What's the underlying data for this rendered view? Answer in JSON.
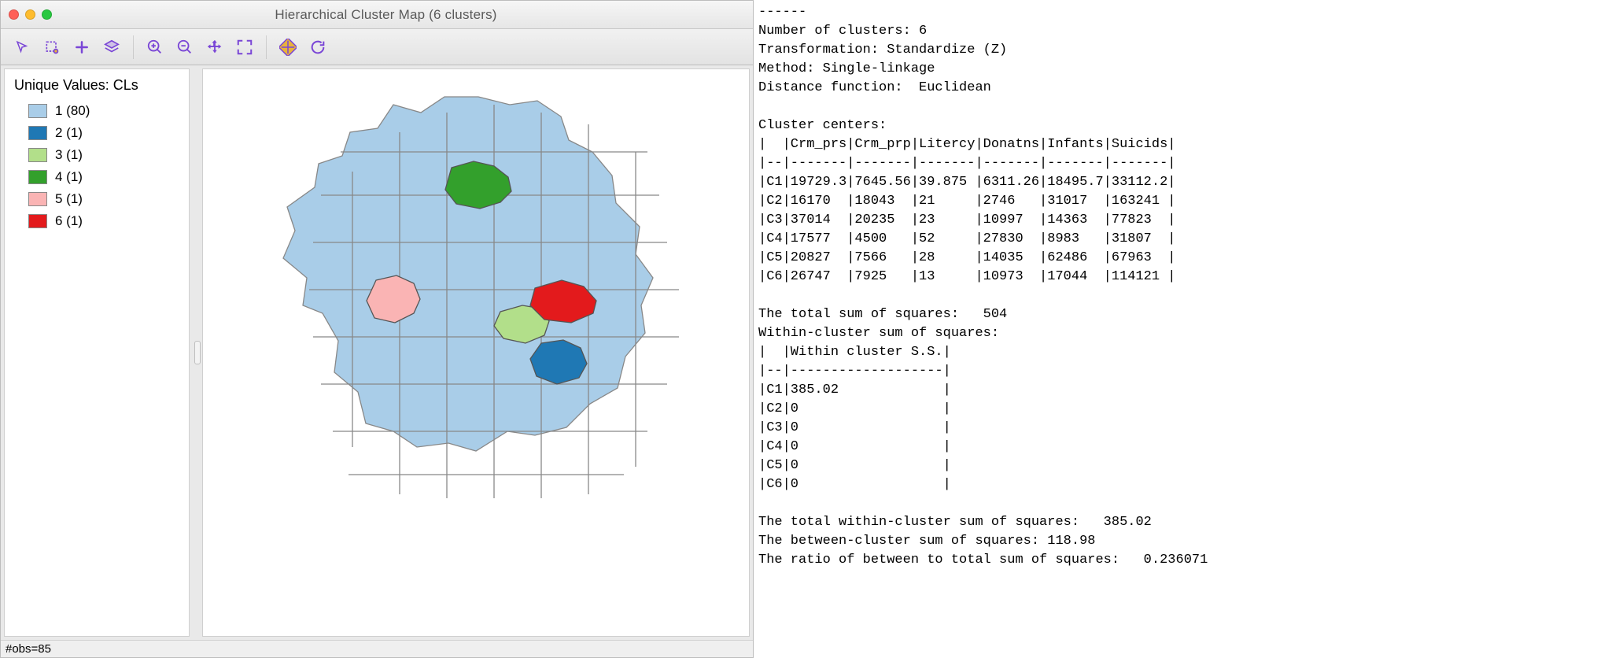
{
  "window": {
    "title": "Hierarchical Cluster Map (6 clusters)"
  },
  "toolbar": {
    "icons": [
      "pointer-icon",
      "select-rect-icon",
      "add-icon",
      "layers-icon",
      "zoom-in-icon",
      "zoom-out-icon",
      "pan-icon",
      "fit-icon",
      "basemap-icon",
      "refresh-icon"
    ]
  },
  "legend": {
    "title": "Unique Values: CLs",
    "items": [
      {
        "label": "1 (80)",
        "color": "#a9cde8"
      },
      {
        "label": "2 (1)",
        "color": "#1f78b4"
      },
      {
        "label": "3 (1)",
        "color": "#b2df8a"
      },
      {
        "label": "4 (1)",
        "color": "#33a02c"
      },
      {
        "label": "5 (1)",
        "color": "#fab4b4"
      },
      {
        "label": "6 (1)",
        "color": "#e31a1c"
      }
    ]
  },
  "statusbar": {
    "obs": "#obs=85"
  },
  "report": {
    "separator": "------",
    "num_clusters_label": "Number of clusters:",
    "num_clusters": "6",
    "transformation_label": "Transformation:",
    "transformation": "Standardize (Z)",
    "method_label": "Method:",
    "method": "Single-linkage",
    "distfn_label": "Distance function:",
    "distfn": "Euclidean",
    "centers_title": "Cluster centers:",
    "centers_header": [
      "",
      "Crm_prs",
      "Crm_prp",
      "Litercy",
      "Donatns",
      "Infants",
      "Suicids"
    ],
    "centers_rows": [
      [
        "C1",
        "19729.3",
        "7645.56",
        "39.875",
        "6311.26",
        "18495.7",
        "33112.2"
      ],
      [
        "C2",
        "16170",
        "18043",
        "21",
        "2746",
        "31017",
        "163241"
      ],
      [
        "C3",
        "37014",
        "20235",
        "23",
        "10997",
        "14363",
        "77823"
      ],
      [
        "C4",
        "17577",
        "4500",
        "52",
        "27830",
        "8983",
        "31807"
      ],
      [
        "C5",
        "20827",
        "7566",
        "28",
        "14035",
        "62486",
        "67963"
      ],
      [
        "C6",
        "26747",
        "7925",
        "13",
        "10973",
        "17044",
        "114121"
      ]
    ],
    "total_ss_label": "The total sum of squares:",
    "total_ss": "504",
    "within_title": "Within-cluster sum of squares:",
    "within_header": [
      "",
      "Within cluster S.S."
    ],
    "within_rows": [
      [
        "C1",
        "385.02"
      ],
      [
        "C2",
        "0"
      ],
      [
        "C3",
        "0"
      ],
      [
        "C4",
        "0"
      ],
      [
        "C5",
        "0"
      ],
      [
        "C6",
        "0"
      ]
    ],
    "total_within_label": "The total within-cluster sum of squares:",
    "total_within": "385.02",
    "between_label": "The between-cluster sum of squares:",
    "between": "118.98",
    "ratio_label": "The ratio of between to total sum of squares:",
    "ratio": "0.236071"
  }
}
